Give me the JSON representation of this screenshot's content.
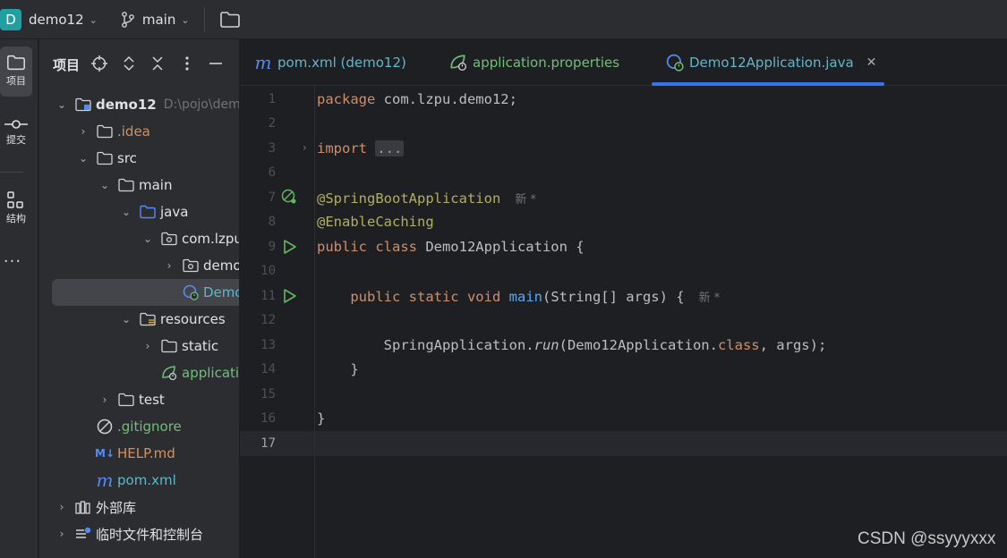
{
  "titlebar": {
    "project_badge": "D",
    "project_name": "demo12",
    "branch_name": "main"
  },
  "toolstrip": {
    "project_label": "项目",
    "commit_label": "提交",
    "structure_label": "结构",
    "more": "···"
  },
  "project_panel": {
    "title": "项目",
    "tree": {
      "root_name": "demo12",
      "root_path": "D:\\pojo\\dem",
      "idea": ".idea",
      "src": "src",
      "main": "main",
      "java": "java",
      "package": "com.lzpu",
      "subpackage": "demo",
      "app_class": "Demo",
      "resources": "resources",
      "static": "static",
      "app_props": "applicati",
      "test": "test",
      "gitignore": ".gitignore",
      "help_md": "HELP.md",
      "pom": "pom.xml",
      "external_libs": "外部库",
      "scratches": "临时文件和控制台"
    },
    "help_md_badge": "M↓"
  },
  "editor": {
    "tabs": [
      {
        "label": "pom.xml (demo12)"
      },
      {
        "label": "application.properties"
      },
      {
        "label": "Demo12Application.java"
      }
    ],
    "pom_icon_glyph": "m",
    "line_numbers": [
      "1",
      "2",
      "3",
      "6",
      "7",
      "8",
      "9",
      "10",
      "11",
      "12",
      "13",
      "14",
      "15",
      "16",
      "17"
    ],
    "code": {
      "l1_kw": "package",
      "l1_rest": " com.lzpu.demo12;",
      "l3_kw": "import",
      "l3_fold": "...",
      "l7_ann": "@SpringBootApplication",
      "l7_hint": "新 *",
      "l8_ann": "@EnableCaching",
      "l9_kw": "public class",
      "l9_rest": " Demo12Application {",
      "l11_kw": "public static void",
      "l11_fn": "main",
      "l11_rest": "(String[] args) {",
      "l11_hint": "新 *",
      "l13_a": "SpringApplication.",
      "l13_run": "run",
      "l13_b": "(Demo12Application.",
      "l13_kw": "class",
      "l13_c": ", args);",
      "l14": "}",
      "l16": "}"
    }
  },
  "watermark": "CSDN @ssyyyxxx",
  "colors": {
    "accent": "#3574f0",
    "keyword": "#cf8e6d",
    "annotation": "#b3ae60",
    "function": "#56a8f5",
    "run_green": "#5fb85f",
    "folder_blue": "#548af7"
  }
}
